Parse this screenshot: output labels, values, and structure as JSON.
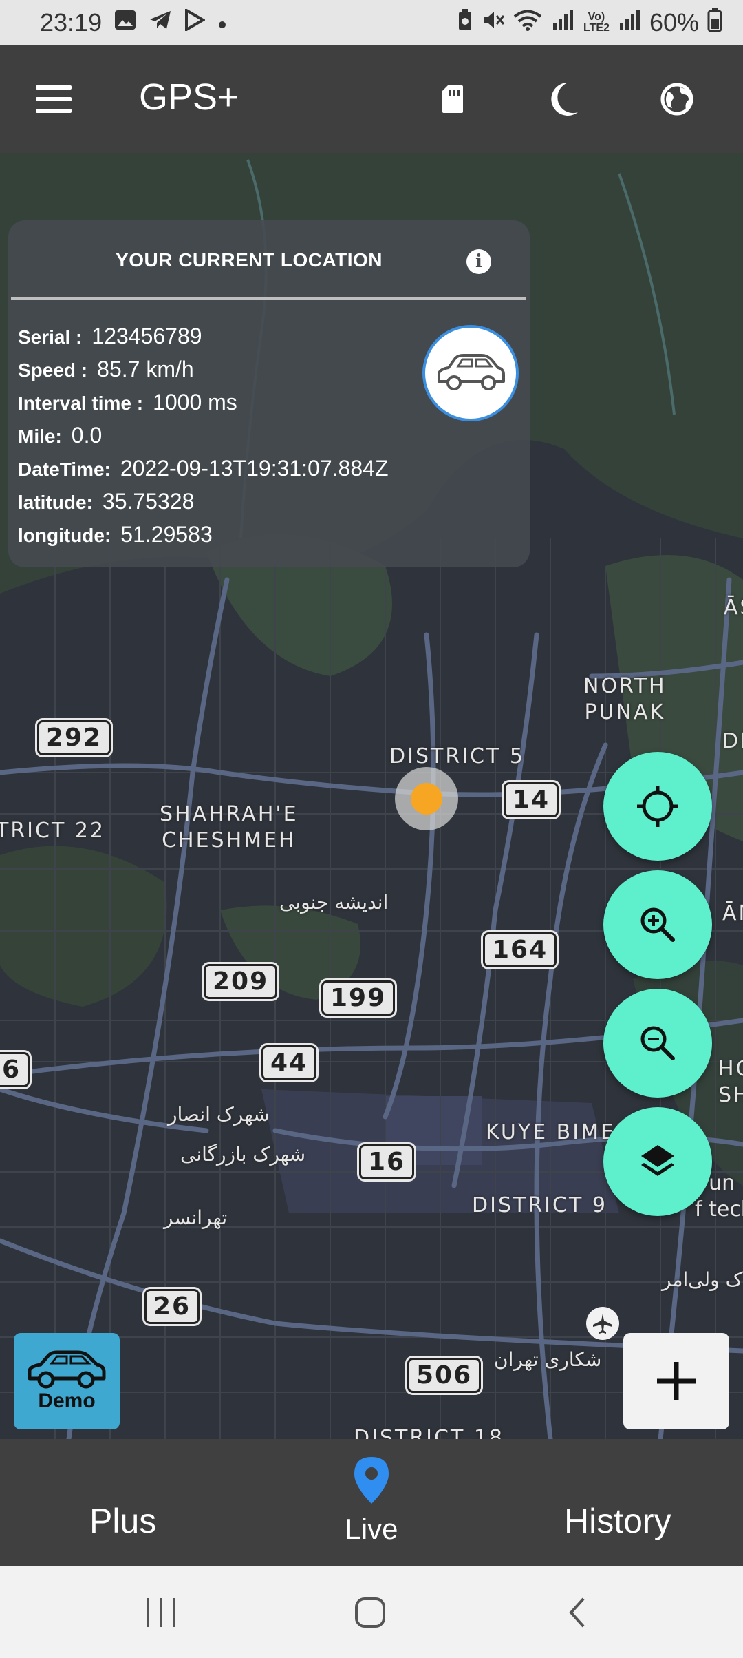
{
  "status_bar": {
    "time": "23:19",
    "battery": "60%",
    "left_icons": [
      "image-icon",
      "telegram-icon",
      "play-store-icon",
      "dot-icon"
    ],
    "right_icons": [
      "battery-saver-icon",
      "mute-icon",
      "wifi-icon",
      "signal-r-icon",
      "volte-icon",
      "signal-icon",
      "battery-icon"
    ]
  },
  "app_bar": {
    "title": "GPS+",
    "icons": [
      "menu-icon",
      "sd-card-icon",
      "dark-mode-icon",
      "globe-icon"
    ]
  },
  "info_card": {
    "title": "YOUR CURRENT LOCATION",
    "rows": [
      {
        "key": "Serial :",
        "value": "123456789"
      },
      {
        "key": "Speed :",
        "value": "85.7 km/h"
      },
      {
        "key": "Interval time :",
        "value": "1000 ms"
      },
      {
        "key": "Mile:",
        "value": "0.0"
      },
      {
        "key": "DateTime:",
        "value": "2022-09-13T19:31:07.884Z"
      },
      {
        "key": "latitude:",
        "value": "35.75328"
      },
      {
        "key": "longitude:",
        "value": "51.29583"
      }
    ]
  },
  "map": {
    "road_labels": [
      "292",
      "14",
      "164",
      "209",
      "199",
      "44",
      "16",
      "26",
      "506",
      "6"
    ],
    "area_labels": {
      "north_punak": "NORTH\nPUNAK",
      "district_5": "DISTRICT 5",
      "district_22": "TRICT 22",
      "shahrah": "SHAHRAH'E\nCHESHMEH",
      "kuye_bimeh": "KUYE BIMEH",
      "district_9": "DISTRICT 9",
      "district_18": "DISTRICT 18",
      "a_s": "ĀS",
      "d_i": "DI",
      "a_n": "ĀN",
      "hom": "HOM\nSH",
      "tech": "f un\nf tech"
    },
    "fa_labels": {
      "andisheh": "اندیشه جنوبی",
      "ansar": "شهرک انصار",
      "bazargani": "شهرک بازرگانی",
      "tehransar": "تهرانسر",
      "shekari": "شکاری تهران",
      "valiasr": "ک ولی‌امر"
    }
  },
  "fabs": [
    "locate-icon",
    "zoom-in-icon",
    "zoom-out-icon",
    "layers-icon"
  ],
  "demo_button": {
    "label": "Demo"
  },
  "bottom_nav": {
    "plus": "Plus",
    "live": "Live",
    "history": "History"
  },
  "colors": {
    "accent": "#5ef0cc",
    "marker": "#f6a623",
    "demo": "#3fa8d0",
    "live_pin": "#2f8ef0"
  }
}
